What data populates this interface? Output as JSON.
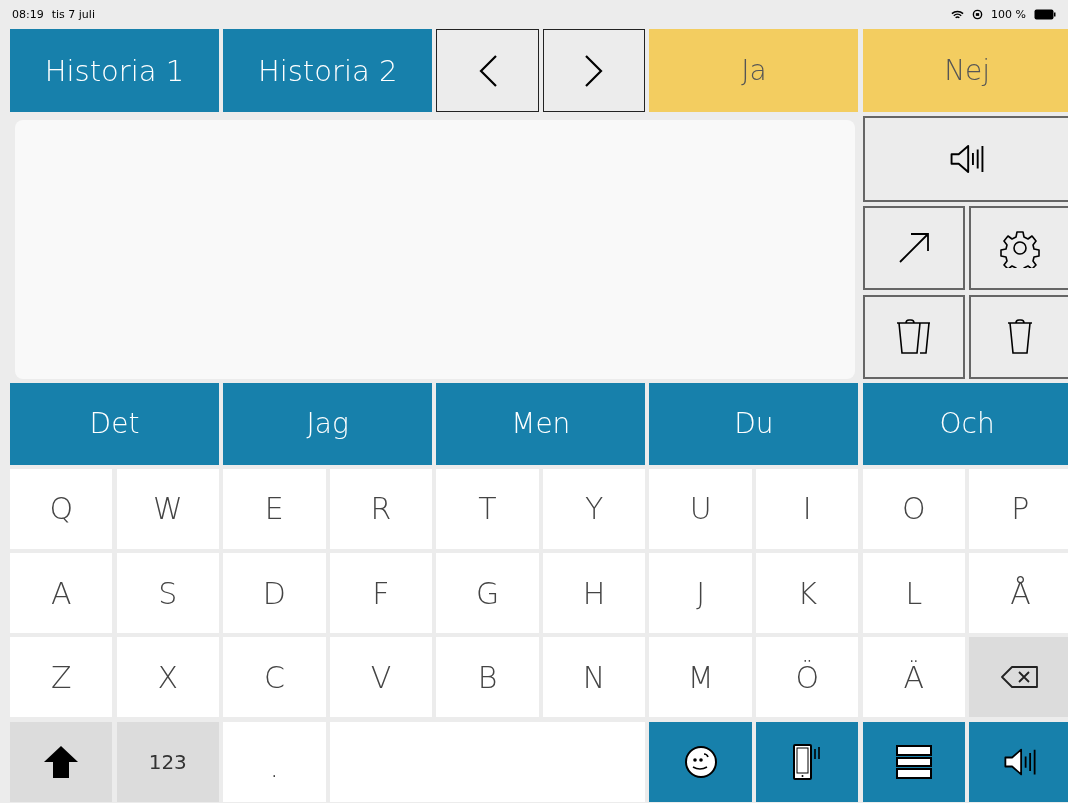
{
  "status_bar": {
    "time": "08:19",
    "date": "tis 7 juli",
    "battery": "100 %"
  },
  "top_bar": [
    {
      "kind": "history",
      "label": "Historia 1"
    },
    {
      "kind": "history",
      "label": "Historia 2"
    },
    {
      "kind": "back"
    },
    {
      "kind": "forward"
    },
    {
      "kind": "answer",
      "label": "Ja"
    },
    {
      "kind": "answer",
      "label": "Nej"
    }
  ],
  "word_predictions": [
    "Det",
    "Jag",
    "Men",
    "Du",
    "Och"
  ],
  "keyboard": [
    [
      {
        "kind": "letter",
        "label": "Q"
      },
      {
        "kind": "letter",
        "label": "W"
      },
      {
        "kind": "letter",
        "label": "E"
      },
      {
        "kind": "letter",
        "label": "R"
      },
      {
        "kind": "letter",
        "label": "T"
      },
      {
        "kind": "letter",
        "label": "Y"
      },
      {
        "kind": "letter",
        "label": "U"
      },
      {
        "kind": "letter",
        "label": "I"
      },
      {
        "kind": "letter",
        "label": "O"
      },
      {
        "kind": "letter",
        "label": "P"
      }
    ],
    [
      {
        "kind": "letter",
        "label": "A"
      },
      {
        "kind": "letter",
        "label": "S"
      },
      {
        "kind": "letter",
        "label": "D"
      },
      {
        "kind": "letter",
        "label": "F"
      },
      {
        "kind": "letter",
        "label": "G"
      },
      {
        "kind": "letter",
        "label": "H"
      },
      {
        "kind": "letter",
        "label": "J"
      },
      {
        "kind": "letter",
        "label": "K"
      },
      {
        "kind": "letter",
        "label": "L"
      },
      {
        "kind": "letter",
        "label": "Å"
      }
    ],
    [
      {
        "kind": "letter",
        "label": "Z"
      },
      {
        "kind": "letter",
        "label": "X"
      },
      {
        "kind": "letter",
        "label": "C"
      },
      {
        "kind": "letter",
        "label": "V"
      },
      {
        "kind": "letter",
        "label": "B"
      },
      {
        "kind": "letter",
        "label": "N"
      },
      {
        "kind": "letter",
        "label": "M"
      },
      {
        "kind": "letter",
        "label": "Ö"
      },
      {
        "kind": "letter",
        "label": "Ä"
      },
      {
        "kind": "backspace"
      }
    ],
    [
      {
        "kind": "shift"
      },
      {
        "kind": "mode",
        "label": "123"
      },
      {
        "kind": "period",
        "label": "."
      },
      {
        "kind": "space"
      },
      {
        "kind": "emoji"
      },
      {
        "kind": "device"
      },
      {
        "kind": "menu"
      },
      {
        "kind": "speak"
      }
    ]
  ]
}
